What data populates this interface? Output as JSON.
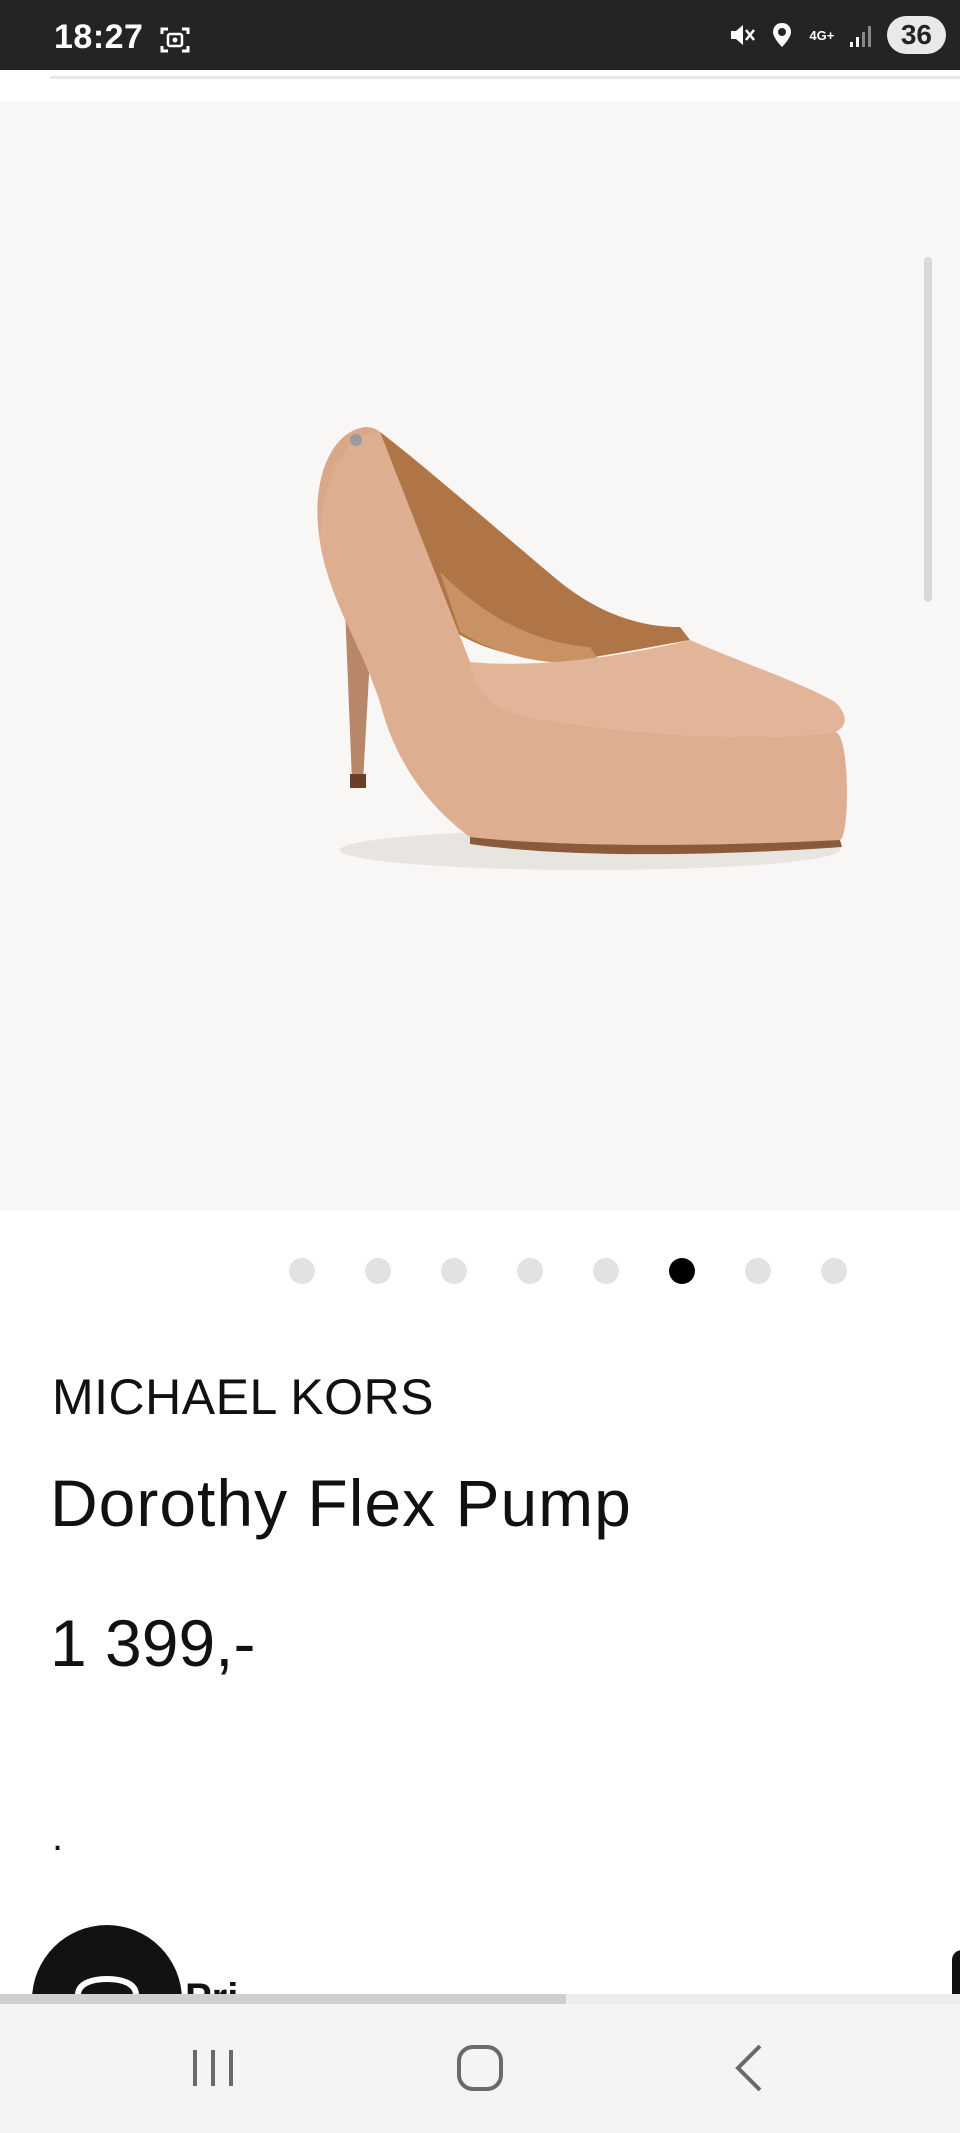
{
  "status_bar": {
    "time": "18:27",
    "network_label": "4G+",
    "battery": "36",
    "icons": [
      "screenshot-icon",
      "mute-icon",
      "location-icon",
      "network-icon",
      "signal-icon",
      "battery-icon"
    ]
  },
  "product": {
    "image_alt_name": "pump-shoe-image",
    "brand": "MICHAEL KORS",
    "name": "Dorothy Flex Pump",
    "price": "1 399,-",
    "extra_text": "."
  },
  "carousel": {
    "total": 8,
    "active_index": 5
  },
  "bottom": {
    "partial_label": "Pri",
    "progress_fraction": 0.59
  },
  "colors": {
    "status_bar_bg": "#242424",
    "image_bg": "#f9f7f5",
    "dot_inactive": "#e2e2e2",
    "dot_active": "#000000",
    "nav_bg": "#f4f4f4",
    "shoe": "#e0b395"
  },
  "nav": {
    "items": [
      "recents-icon",
      "home-icon",
      "back-icon"
    ]
  }
}
